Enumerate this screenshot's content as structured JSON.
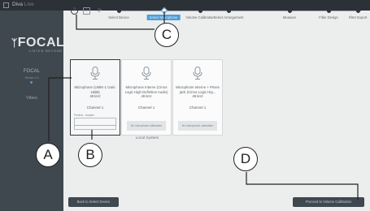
{
  "app": {
    "title": "Diva",
    "title_suffix": "Live"
  },
  "sidebar": {
    "brand": "FOCAL",
    "brand_tagline": "LISTEN BEYOND",
    "device_name": "FOCAL",
    "device_serial": "Serial 1.0",
    "device_model": "Vibes"
  },
  "toolbar": {
    "help_glyph": "?",
    "info_glyph": "i",
    "refresh_glyph": "⟳"
  },
  "steps": [
    {
      "label": "Select Device",
      "state": "done"
    },
    {
      "label": "Select Microphone",
      "state": "current"
    },
    {
      "label": "Volume Calibration",
      "state": "todo"
    },
    {
      "label": "Select Arrangement",
      "state": "todo"
    },
    {
      "label": "Measure",
      "state": "todo"
    },
    {
      "label": "Filter Design",
      "state": "todo"
    },
    {
      "label": "Filter Export",
      "state": "todo"
    }
  ],
  "microphones": [
    {
      "name": "Microphone (UMIK-1 Gain: 18dB)",
      "rate": "48 kHz",
      "channel": "Channel 1",
      "selected": true,
      "meter_label": "Preview - Ampaln"
    },
    {
      "name": "Microphone Interne (Cirrus Logic High Definition Audio)",
      "rate": "48 kHz",
      "channel": "Channel 1",
      "selected": false,
      "footer": "No microphone calibration"
    },
    {
      "name": "Microphone Interne + Prises jack (Cirrus Logic Hig...",
      "rate": "48 kHz",
      "channel": "Channel 1",
      "selected": false,
      "footer": "No microphone calibration"
    }
  ],
  "group_label": "Local System",
  "nav": {
    "back": "Back to Select Device",
    "next": "Proceed to Volume Calibration"
  },
  "callouts": {
    "a": "A",
    "b": "B",
    "c": "C",
    "d": "D"
  },
  "colors": {
    "accent": "#4b9ed9",
    "sidebar": "#3f474f"
  }
}
